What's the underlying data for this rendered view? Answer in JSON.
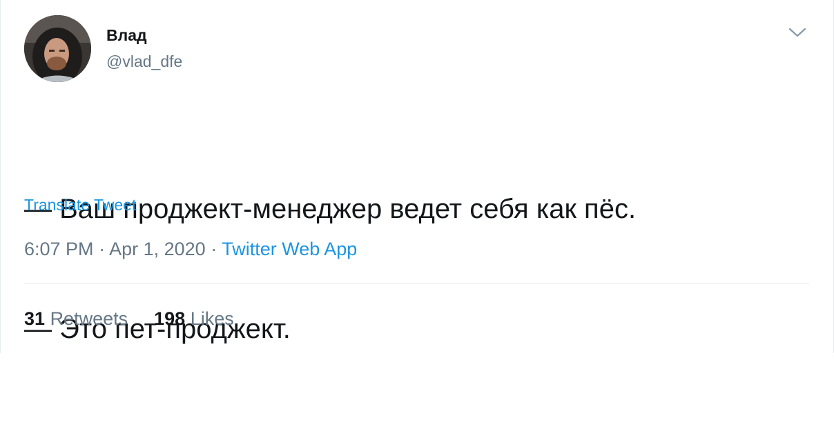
{
  "author": {
    "name": "Влад",
    "handle": "@vlad_dfe"
  },
  "tweet": {
    "lines": [
      "— Ваш проджект-менеджер ведет себя как пёс.",
      "— Это пет-проджект."
    ],
    "translate_label": "Translate Tweet",
    "time": "6:07 PM",
    "separator": " · ",
    "date": "Apr 1, 2020",
    "source": "Twitter Web App"
  },
  "stats": {
    "retweets_count": "31",
    "retweets_label": "Retweets",
    "likes_count": "198",
    "likes_label": "Likes"
  },
  "icons": {
    "menu": "chevron-down-icon"
  },
  "colors": {
    "link": "#1b95e0",
    "secondary_text": "#657786",
    "primary_text": "#14171a",
    "divider": "#e6ecf0"
  }
}
